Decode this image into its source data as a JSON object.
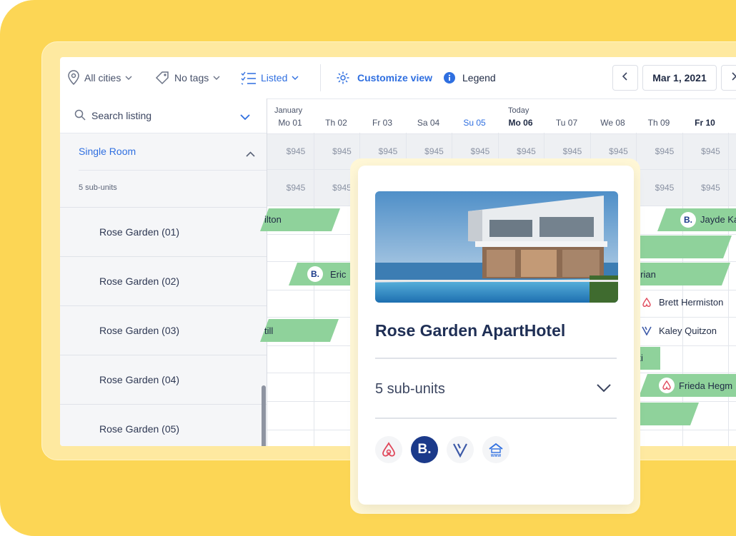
{
  "toolbar": {
    "cities_label": "All cities",
    "tags_label": "No tags",
    "listed_label": "Listed",
    "customize_label": "Customize view",
    "legend_label": "Legend",
    "date_label": "Mar 1, 2021"
  },
  "sidebar": {
    "search_label": "Search listing",
    "group_label": "Single Room",
    "sub_units_label": "5 sub-units",
    "units": [
      {
        "label": "Rose Garden (01)"
      },
      {
        "label": "Rose Garden (02)"
      },
      {
        "label": "Rose Garden (03)"
      },
      {
        "label": "Rose Garden (04)"
      },
      {
        "label": "Rose Garden (05)"
      }
    ]
  },
  "calendar": {
    "month_label": "January",
    "today_label": "Today",
    "days": [
      "Mo 01",
      "Th 02",
      "Fr 03",
      "Sa 04",
      "Su 05",
      "Mo 06",
      "Tu 07",
      "We 08",
      "Th 09",
      "Fr 10"
    ],
    "price": "$945",
    "reservations": [
      {
        "name": "ilton"
      },
      {
        "name": "Jayde Ka"
      },
      {
        "name": "Eric"
      },
      {
        "name": "hirian"
      },
      {
        "name": "Brett Hermiston"
      },
      {
        "name": "till"
      },
      {
        "name": "Kaley Quitzon"
      },
      {
        "name": "ski"
      },
      {
        "name": "Frieda Hegm"
      }
    ]
  },
  "card": {
    "title": "Rose Garden ApartHotel",
    "sub_units": "5 sub-units",
    "channels": [
      "airbnb-icon",
      "booking-icon",
      "vrbo-icon",
      "website-icon"
    ]
  },
  "colors": {
    "accent": "#2f6fe0",
    "reservation": "#8fd29b",
    "background": "#fcd655",
    "title": "#1f2f55"
  }
}
